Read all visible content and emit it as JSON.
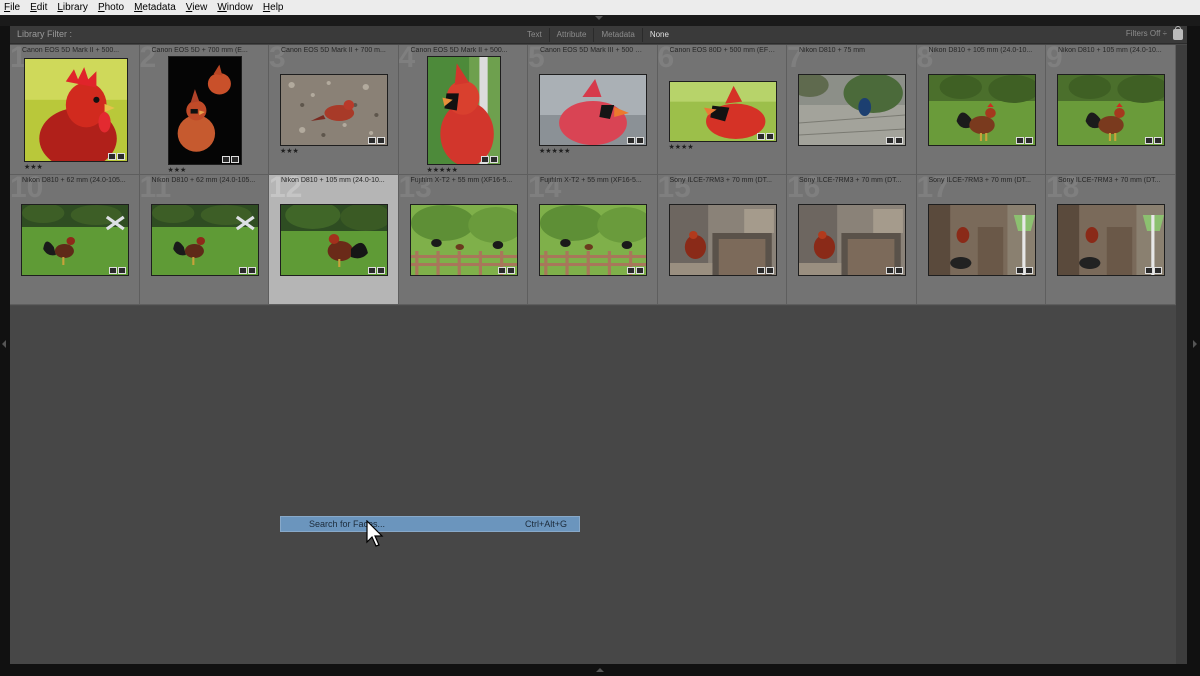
{
  "menubar": {
    "items": [
      {
        "u": "F",
        "rest": "ile"
      },
      {
        "u": "E",
        "rest": "dit"
      },
      {
        "u": "L",
        "rest": "ibrary"
      },
      {
        "u": "P",
        "rest": "hoto"
      },
      {
        "u": "M",
        "rest": "etadata"
      },
      {
        "u": "V",
        "rest": "iew"
      },
      {
        "u": "W",
        "rest": "indow"
      },
      {
        "u": "H",
        "rest": "elp"
      }
    ]
  },
  "filterbar": {
    "label": "Library Filter :",
    "tabs": [
      "Text",
      "Attribute",
      "Metadata",
      "None"
    ],
    "active_tab": "None",
    "filters_off": "Filters Off ÷"
  },
  "grid": {
    "cells": [
      {
        "num": "1",
        "caption": "Canon EOS 5D Mark II + 500...",
        "stars": "★★★",
        "subject": "rooster-closeup"
      },
      {
        "num": "2",
        "caption": "Canon EOS 5D + 700 mm (E...",
        "stars": "★★★",
        "subject": "cardinals-black"
      },
      {
        "num": "3",
        "caption": "Canon EOS 5D Mark II + 700 m...",
        "stars": "★★★",
        "subject": "cardinal-ground"
      },
      {
        "num": "4",
        "caption": "Canon EOS 5D Mark II + 500...",
        "stars": "★★★★★",
        "subject": "cardinal-portrait"
      },
      {
        "num": "5",
        "caption": "Canon EOS 5D Mark III + 500 m...",
        "stars": "★★★★★",
        "subject": "cardinal-head"
      },
      {
        "num": "6",
        "caption": "Canon EOS 80D + 500 mm (EF5...",
        "stars": "★★★★",
        "subject": "cardinal-green"
      },
      {
        "num": "7",
        "caption": "Nikon D810 + 75 mm",
        "stars": "",
        "subject": "peacock"
      },
      {
        "num": "8",
        "caption": "Nikon D810 + 105 mm (24.0-10...",
        "stars": "",
        "subject": "rooster-garden"
      },
      {
        "num": "9",
        "caption": "Nikon D810 + 105 mm (24.0-10...",
        "stars": "",
        "subject": "rooster-garden"
      },
      {
        "num": "10",
        "caption": "Nikon D810 + 62 mm (24.0-105...",
        "stars": "",
        "subject": "rooster-lawn"
      },
      {
        "num": "11",
        "caption": "Nikon D810 + 62 mm (24.0-105...",
        "stars": "",
        "subject": "rooster-lawn"
      },
      {
        "num": "12",
        "caption": "Nikon D810 + 105 mm (24.0-10...",
        "stars": "",
        "subject": "rooster-lawn2"
      },
      {
        "num": "13",
        "caption": "Fujifilm X-T2 + 55 mm (XF16-5...",
        "stars": "",
        "subject": "chickens-fence"
      },
      {
        "num": "14",
        "caption": "Fujifilm X-T2 + 55 mm (XF16-5...",
        "stars": "",
        "subject": "chickens-fence"
      },
      {
        "num": "15",
        "caption": "Sony ILCE-7RM3 + 70 mm (DT...",
        "stars": "",
        "subject": "hen-coop"
      },
      {
        "num": "16",
        "caption": "Sony ILCE-7RM3 + 70 mm (DT...",
        "stars": "",
        "subject": "hen-coop"
      },
      {
        "num": "17",
        "caption": "Sony ILCE-7RM3 + 70 mm (DT...",
        "stars": "",
        "subject": "coop-bucket"
      },
      {
        "num": "18",
        "caption": "Sony ILCE-7RM3 + 70 mm (DT...",
        "stars": "",
        "subject": "coop-bucket"
      }
    ],
    "selected_index": 11
  },
  "context_menu": {
    "label": "Search for Faces...",
    "shortcut": "Ctrl+Alt+G"
  },
  "colors": {
    "menubar": "#ececec",
    "panel": "#474747",
    "cell": "#737373",
    "cell_selected": "#b5b5b5",
    "menu_highlight": "#6b95bd"
  }
}
